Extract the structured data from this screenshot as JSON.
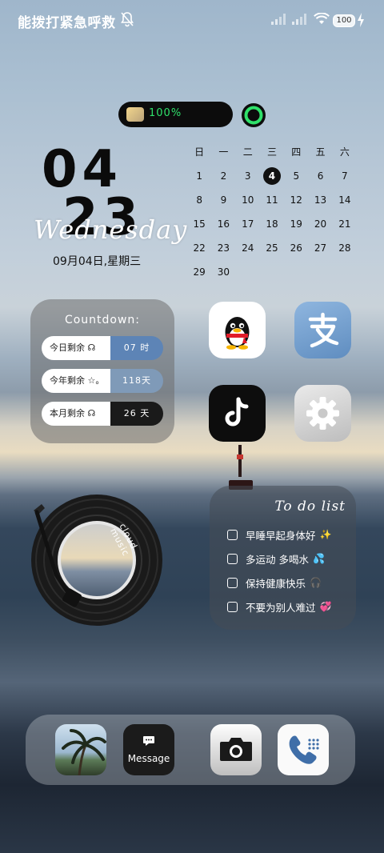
{
  "status_bar": {
    "carrier": "能拨打紧急呼救",
    "battery_level": "100"
  },
  "battery_widget": {
    "percent": "100%",
    "ring_level": 1.0
  },
  "clock": {
    "hour": "04",
    "minute": "23",
    "weekday_script": "Wednesday",
    "date_line": "09月04日,星期三"
  },
  "calendar": {
    "weekdays": [
      "日",
      "一",
      "二",
      "三",
      "四",
      "五",
      "六"
    ],
    "weeks": [
      [
        "1",
        "2",
        "3",
        "4",
        "5",
        "6",
        "7"
      ],
      [
        "8",
        "9",
        "10",
        "11",
        "12",
        "13",
        "14"
      ],
      [
        "15",
        "16",
        "17",
        "18",
        "19",
        "20",
        "21"
      ],
      [
        "22",
        "23",
        "24",
        "25",
        "26",
        "27",
        "28"
      ],
      [
        "29",
        "30",
        "",
        "",
        "",
        "",
        ""
      ]
    ],
    "today": "4"
  },
  "countdown": {
    "title": "Countdown:",
    "rows": [
      {
        "label": "今日剩余 ☊",
        "value": "07 时",
        "color": "#5d84b6"
      },
      {
        "label": "今年剩余 ☆。",
        "value": "118天",
        "color": "#7f9ab8"
      },
      {
        "label": "本月剩余 ☊",
        "value": "26 天",
        "color": "#1a1a1a"
      }
    ]
  },
  "apps": {
    "qq": "qq-icon",
    "alipay": "alipay-icon",
    "tiktok": "tiktok-icon",
    "settings": "gear-icon"
  },
  "music": {
    "label": "cloud music"
  },
  "todo": {
    "title": "To do list",
    "items": [
      {
        "text": "早睡早起身体好",
        "emoji": "✨"
      },
      {
        "text": "多运动 多喝水",
        "emoji": "💦"
      },
      {
        "text": "保持健康快乐",
        "emoji": "🎧"
      },
      {
        "text": "不要为别人难过",
        "emoji": "💞"
      }
    ]
  },
  "dock": {
    "message_label": "Message"
  }
}
